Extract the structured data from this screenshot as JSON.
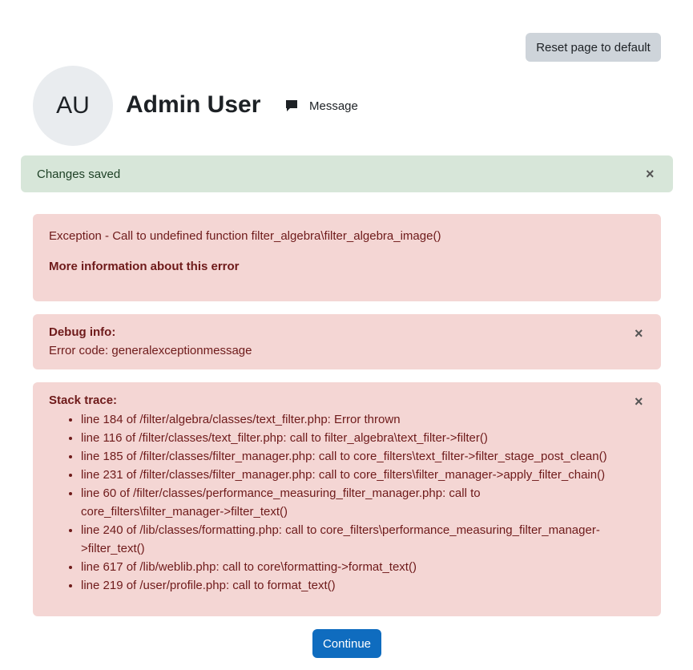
{
  "header": {
    "reset_label": "Reset page to default",
    "avatar_initials": "AU",
    "user_name": "Admin User",
    "message_label": "Message"
  },
  "success_alert": {
    "text": "Changes saved",
    "close_symbol": "×"
  },
  "error": {
    "message": "Exception - Call to undefined function filter_algebra\\filter_algebra_image()",
    "more_info": "More information about this error"
  },
  "debug": {
    "title": "Debug info:",
    "code": "Error code: generalexceptionmessage",
    "close_symbol": "×"
  },
  "stack": {
    "title": "Stack trace:",
    "close_symbol": "×",
    "lines": [
      "line 184 of /filter/algebra/classes/text_filter.php: Error thrown",
      "line 116 of /filter/classes/text_filter.php: call to filter_algebra\\text_filter->filter()",
      "line 185 of /filter/classes/filter_manager.php: call to core_filters\\text_filter->filter_stage_post_clean()",
      "line 231 of /filter/classes/filter_manager.php: call to core_filters\\filter_manager->apply_filter_chain()",
      "line 60 of /filter/classes/performance_measuring_filter_manager.php: call to core_filters\\filter_manager->filter_text()",
      "line 240 of /lib/classes/formatting.php: call to core_filters\\performance_measuring_filter_manager->filter_text()",
      "line 617 of /lib/weblib.php: call to core\\formatting->format_text()",
      "line 219 of /user/profile.php: call to format_text()"
    ]
  },
  "footer": {
    "continue_label": "Continue"
  },
  "colors": {
    "primary": "#0f6cbf",
    "success_bg": "#d7e6d9",
    "danger_bg": "#f4d6d4",
    "danger_text": "#6e1a1a"
  }
}
